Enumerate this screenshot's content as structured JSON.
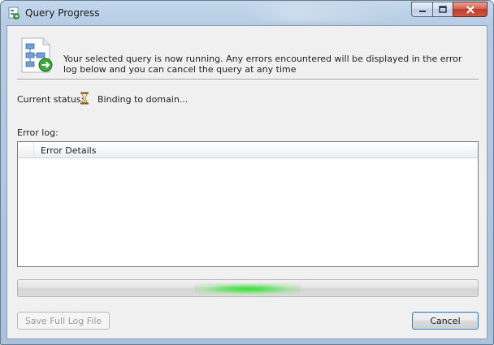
{
  "window": {
    "title": "Query Progress"
  },
  "header": {
    "message": "Your selected query is now running. Any errors encountered will be displayed in the error log below and you can cancel the query at any time"
  },
  "status": {
    "label": "Current status:",
    "value": "Binding to domain..."
  },
  "error_log": {
    "label": "Error log:",
    "columns": [
      "",
      "Error Details"
    ],
    "rows": []
  },
  "progress": {
    "mode": "indeterminate",
    "glow_position": 0.5
  },
  "buttons": {
    "save_log": "Save Full Log File",
    "cancel": "Cancel"
  },
  "colors": {
    "accent_glow": "#32dc32",
    "close_button": "#c0392b",
    "default_button_border": "#3c7fb1"
  },
  "icons": {
    "title": "query-window-icon",
    "header": "query-tree-run-icon",
    "status": "hourglass-icon"
  }
}
